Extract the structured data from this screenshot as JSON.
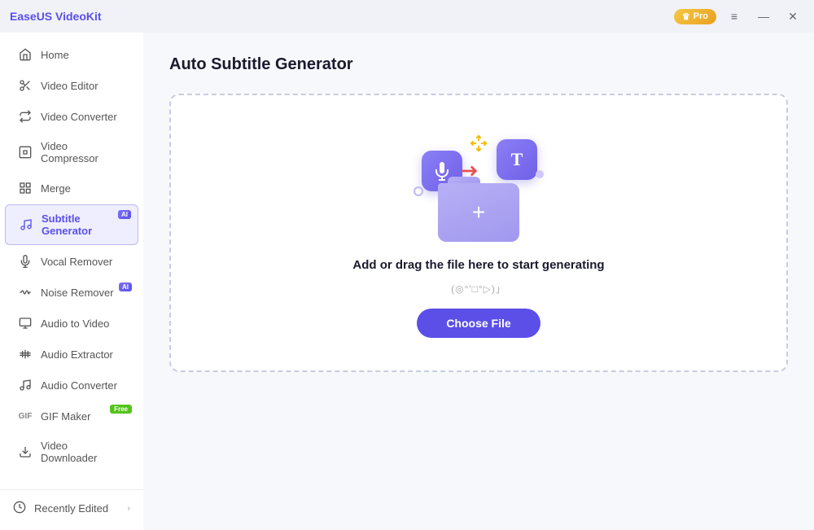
{
  "titlebar": {
    "logo": "EaseUS VideoKit",
    "pro_label": "Pro",
    "btn_menu": "≡",
    "btn_minimize": "—",
    "btn_close": "✕"
  },
  "sidebar": {
    "items": [
      {
        "id": "home",
        "label": "Home",
        "icon": "⌂",
        "active": false
      },
      {
        "id": "video-editor",
        "label": "Video Editor",
        "icon": "✂",
        "active": false
      },
      {
        "id": "video-converter",
        "label": "Video Converter",
        "icon": "↺",
        "active": false
      },
      {
        "id": "video-compressor",
        "label": "Video Compressor",
        "icon": "⊡",
        "active": false
      },
      {
        "id": "merge",
        "label": "Merge",
        "icon": "⊞",
        "active": false
      },
      {
        "id": "subtitle-generator",
        "label": "Subtitle Generator",
        "icon": "♫",
        "active": true,
        "badge": "AI"
      },
      {
        "id": "vocal-remover",
        "label": "Vocal Remover",
        "icon": "🎤",
        "active": false
      },
      {
        "id": "noise-remover",
        "label": "Noise Remover",
        "icon": "🎛",
        "active": false,
        "badge": "AI"
      },
      {
        "id": "audio-to-video",
        "label": "Audio to Video",
        "icon": "▶",
        "active": false
      },
      {
        "id": "audio-extractor",
        "label": "Audio Extractor",
        "icon": "📊",
        "active": false
      },
      {
        "id": "audio-converter",
        "label": "Audio Converter",
        "icon": "🎵",
        "active": false
      },
      {
        "id": "gif-maker",
        "label": "GIF Maker",
        "icon": "GIF",
        "active": false,
        "badge": "Free"
      },
      {
        "id": "video-downloader",
        "label": "Video Downloader",
        "icon": "⬇",
        "active": false
      }
    ],
    "bottom": {
      "label": "Recently Edited"
    }
  },
  "main": {
    "title": "Auto Subtitle Generator",
    "drop_zone": {
      "main_text": "Add or drag the file here to start generating",
      "sub_text": "(◎°'□°▷)」",
      "button_label": "Choose File"
    }
  }
}
